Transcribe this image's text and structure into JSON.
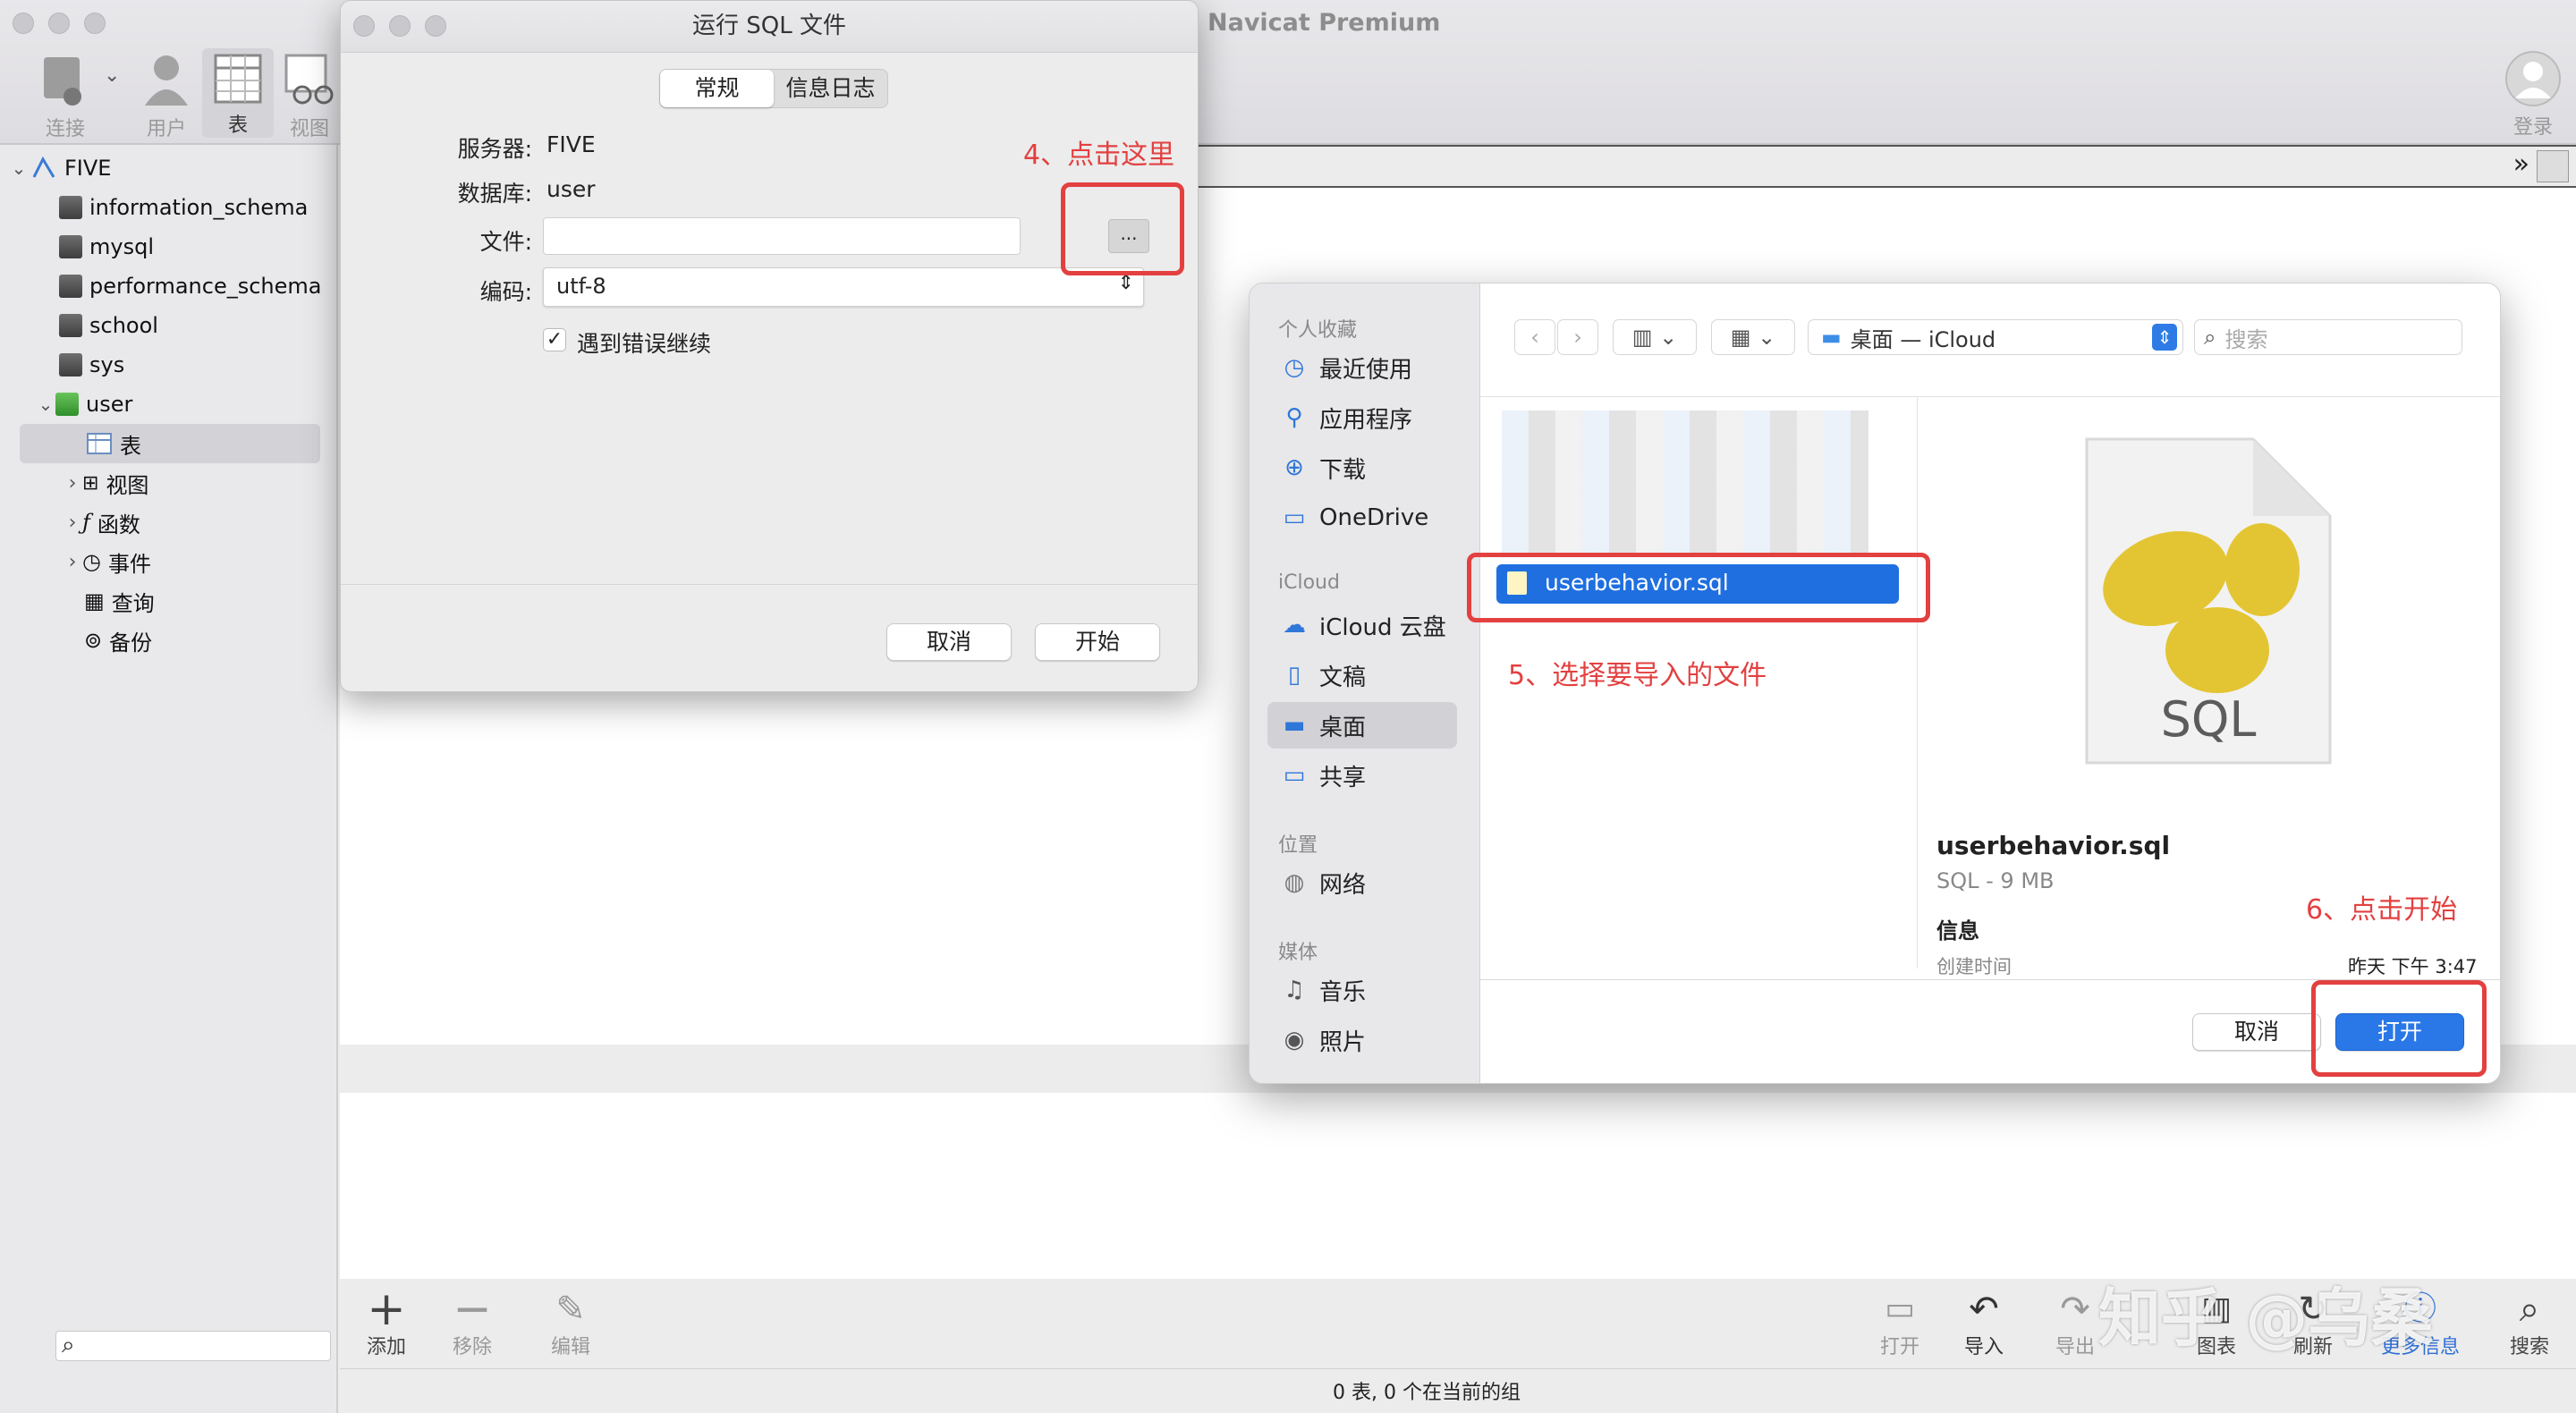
{
  "app": {
    "title": "Navicat Premium",
    "status": "0 表, 0 个在当前的组"
  },
  "toolbar": {
    "connect": "连接",
    "user": "用户",
    "table": "表",
    "view": "视图",
    "login": "登录"
  },
  "tree": {
    "server": "FIVE",
    "databases": [
      "information_schema",
      "mysql",
      "performance_schema",
      "school",
      "sys"
    ],
    "open_db": "user",
    "children": [
      "表",
      "视图",
      "函数",
      "事件",
      "查询",
      "备份"
    ]
  },
  "bottom_toolbar": {
    "add": "添加",
    "remove": "移除",
    "edit": "编辑",
    "open": "打开",
    "import": "导入",
    "export": "导出",
    "chart": "图表",
    "refresh": "刷新",
    "more_info": "更多信息",
    "search": "搜索"
  },
  "watermark": "知乎 @乌桑",
  "sql_dialog": {
    "title": "运行 SQL 文件",
    "tabs": [
      "常规",
      "信息日志"
    ],
    "server_label": "服务器:",
    "server_value": "FIVE",
    "db_label": "数据库:",
    "db_value": "user",
    "file_label": "文件:",
    "file_value": "",
    "browse": "...",
    "encoding_label": "编码:",
    "encoding_value": "utf-8",
    "continue_on_error": "遇到错误继续",
    "cancel": "取消",
    "start": "开始"
  },
  "annotations": {
    "step4": "4、点击这里",
    "step5": "5、选择要导入的文件",
    "step6": "6、点击开始"
  },
  "finder": {
    "favorites_header": "个人收藏",
    "favorites": [
      "最近使用",
      "应用程序",
      "下载",
      "OneDrive"
    ],
    "icloud_header": "iCloud",
    "icloud": [
      "iCloud 云盘",
      "文稿",
      "桌面",
      "共享"
    ],
    "locations_header": "位置",
    "locations": [
      "网络"
    ],
    "media_header": "媒体",
    "media": [
      "音乐",
      "照片"
    ],
    "location_popup": "桌面 — iCloud",
    "search_placeholder": "搜索",
    "selected_file": "userbehavior.sql",
    "preview_name": "userbehavior.sql",
    "preview_meta": "SQL - 9 MB",
    "preview_icon_text": "SQL",
    "info_header": "信息",
    "created_label": "创建时间",
    "created_value": "昨天 下午 3:47",
    "cancel": "取消",
    "open": "打开"
  }
}
